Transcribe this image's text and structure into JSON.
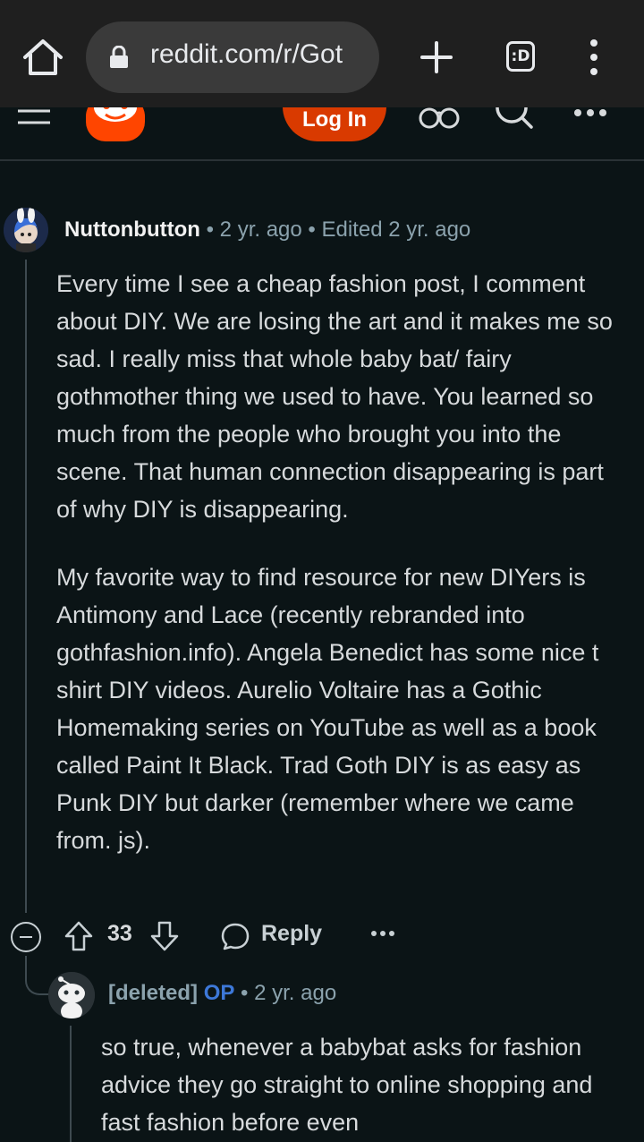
{
  "browser": {
    "url": "reddit.com/r/Got",
    "tab_count_label": ":D"
  },
  "header": {
    "login_label": "Log In"
  },
  "comment": {
    "author": "Nuttonbutton",
    "separator1": "•",
    "age": "2 yr. ago",
    "separator2": "•",
    "edited": "Edited 2 yr. ago",
    "paragraphs": [
      "Every time I see a cheap fashion post, I comment about DIY. We are losing the art and it makes me so sad. I really miss that whole baby bat/ fairy gothmother thing we used to have. You learned so much from the people who brought you into the scene. That human connection disappearing is part of why DIY is disappearing.",
      "My favorite way to find resource for new DIYers is Antimony and Lace (recently rebranded into gothfashion.info). Angela Benedict has some nice t shirt DIY videos. Aurelio Voltaire has a Gothic Homemaking series on YouTube as well as a book called Paint It Black. Trad Goth DIY is as easy as Punk DIY but darker (remember where we came from. js)."
    ],
    "score": "33",
    "reply_label": "Reply"
  },
  "reply": {
    "author": "[deleted]",
    "op_badge": "OP",
    "separator": "•",
    "age": "2 yr. ago",
    "text": "so true, whenever a babybat asks for fashion advice they go straight to online shopping and fast fashion before even"
  },
  "colors": {
    "background": "#0b1416",
    "chrome": "#1f1f1f",
    "accent": "#d93a00",
    "op_blue": "#3d78d8",
    "meta": "#8ba2ad"
  }
}
